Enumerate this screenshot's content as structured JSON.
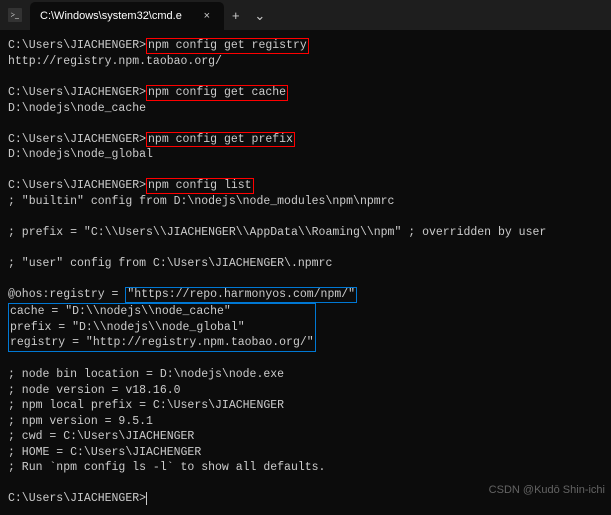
{
  "titlebar": {
    "tab_title": "C:\\Windows\\system32\\cmd.e",
    "add_label": "+",
    "dropdown_label": "⌄"
  },
  "prompt": "C:\\Users\\JIACHENGER>",
  "cmds": {
    "get_registry": "npm config get registry",
    "get_registry_out": "http://registry.npm.taobao.org/",
    "get_cache": "npm config get cache",
    "get_cache_out": "D:\\nodejs\\node_cache",
    "get_prefix": "npm config get prefix",
    "get_prefix_out": "D:\\nodejs\\node_global",
    "list": "npm config list",
    "builtin_line": "; \"builtin\" config from D:\\nodejs\\node_modules\\npm\\npmrc",
    "prefix_line": "; prefix = \"C:\\\\Users\\\\JIACHENGER\\\\AppData\\\\Roaming\\\\npm\" ; overridden by user",
    "user_line": "; \"user\" config from C:\\Users\\JIACHENGER\\.npmrc",
    "ohos_key": "@ohos:registry = ",
    "ohos_val": "\"https://repo.harmonyos.com/npm/\"",
    "cache_kv": "cache = \"D:\\\\nodejs\\\\node_cache\"",
    "prefix_kv": "prefix = \"D:\\\\nodejs\\\\node_global\"",
    "registry_kv": "registry = \"http://registry.npm.taobao.org/\"",
    "info_bin": "; node bin location = D:\\nodejs\\node.exe",
    "info_nodever": "; node version = v18.16.0",
    "info_localprefix": "; npm local prefix = C:\\Users\\JIACHENGER",
    "info_npmver": "; npm version = 9.5.1",
    "info_cwd": "; cwd = C:\\Users\\JIACHENGER",
    "info_home": "; HOME = C:\\Users\\JIACHENGER",
    "info_hint": "; Run `npm config ls -l` to show all defaults."
  },
  "watermark": "CSDN @Kudō Shin-ichi"
}
